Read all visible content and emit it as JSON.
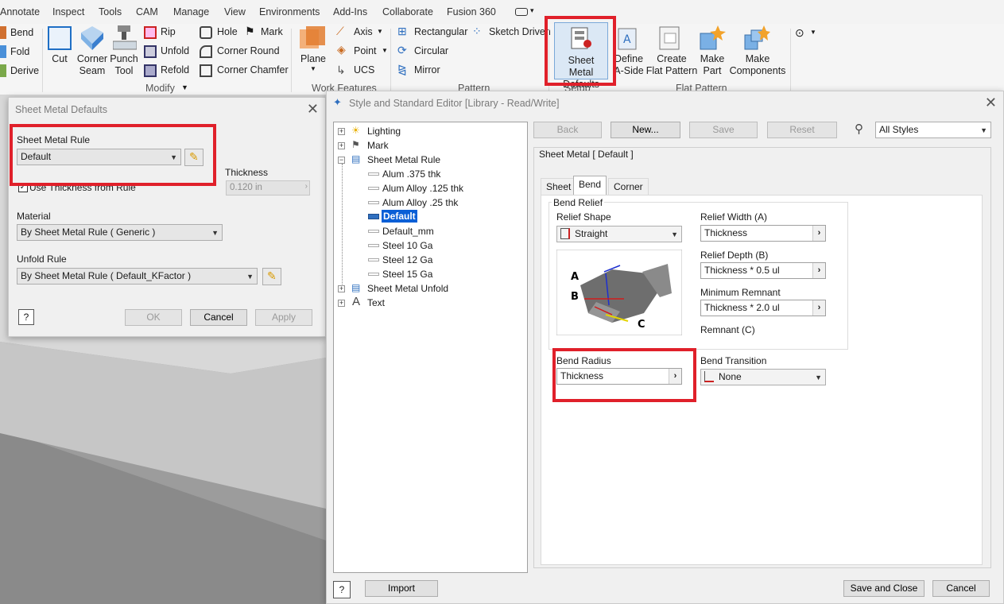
{
  "menubar": {
    "items": [
      "Annotate",
      "Inspect",
      "Tools",
      "CAM",
      "Manage",
      "View",
      "Environments",
      "Add-Ins",
      "Collaborate",
      "Fusion 360"
    ]
  },
  "ribbon": {
    "bend_group": [
      "Bend",
      "Fold",
      "Derive"
    ],
    "modify": {
      "cut": "Cut",
      "corner_seam": [
        "Corner",
        "Seam"
      ],
      "punch_tool": [
        "Punch",
        "Tool"
      ],
      "rip": "Rip",
      "unfold": "Unfold",
      "refold": "Refold",
      "hole": "Hole",
      "mark": "Mark",
      "corner_round": "Corner Round",
      "corner_chamfer": "Corner Chamfer",
      "panel_label": "Modify"
    },
    "work_features": {
      "plane": "Plane",
      "axis": "Axis",
      "point": "Point",
      "ucs": "UCS",
      "panel_label": "Work Features"
    },
    "pattern": {
      "rectangular": "Rectangular",
      "circular": "Circular",
      "mirror": "Mirror",
      "sketch_driven": "Sketch Driven",
      "panel_label": "Pattern"
    },
    "setup": {
      "sheet_metal_defaults": [
        "Sheet Metal",
        "Defaults"
      ],
      "panel_label": "Setup"
    },
    "flat_pattern": {
      "define_a_side": [
        "Define",
        "A-Side"
      ],
      "create_flat_pattern": [
        "Create",
        "Flat Pattern"
      ],
      "make_part": [
        "Make",
        "Part"
      ],
      "make_components": [
        "Make",
        "Components"
      ],
      "panel_label": "Flat Pattern"
    }
  },
  "smd_dialog": {
    "title": "Sheet Metal Defaults",
    "sheet_metal_rule_label": "Sheet Metal Rule",
    "sheet_metal_rule_value": "Default",
    "use_thickness_label": "Use Thickness from Rule",
    "thickness_label": "Thickness",
    "thickness_value": "0.120 in",
    "material_label": "Material",
    "material_value": "By Sheet Metal Rule ( Generic )",
    "unfold_rule_label": "Unfold Rule",
    "unfold_rule_value": "By Sheet Metal Rule ( Default_KFactor )",
    "ok": "OK",
    "cancel": "Cancel",
    "apply": "Apply"
  },
  "sse_dialog": {
    "title": "Style and Standard Editor [Library - Read/Write]",
    "tree": {
      "lighting": "Lighting",
      "mark": "Mark",
      "sheet_metal_rule": "Sheet Metal Rule",
      "children": [
        "Alum .375 thk",
        "Alum Alloy .125 thk",
        "Alum Alloy .25 thk",
        "Default",
        "Default_mm",
        "Steel 10 Ga",
        "Steel 12 Ga",
        "Steel 15 Ga"
      ],
      "sheet_metal_unfold": "Sheet Metal Unfold",
      "text": "Text"
    },
    "toolbar": {
      "back": "Back",
      "new": "New...",
      "save": "Save",
      "reset": "Reset",
      "filter": "All Styles"
    },
    "header": "Sheet Metal [ Default ]",
    "tabs": [
      "Sheet",
      "Bend",
      "Corner"
    ],
    "bend_relief": {
      "group_label": "Bend Relief",
      "relief_shape_label": "Relief Shape",
      "relief_shape_value": "Straight",
      "relief_width_label": "Relief Width (A)",
      "relief_width_value": "Thickness",
      "relief_depth_label": "Relief Depth (B)",
      "relief_depth_value": "Thickness * 0.5 ul",
      "min_remnant_label": "Minimum Remnant",
      "min_remnant_value": "Thickness * 2.0 ul",
      "remnant_label": "Remnant (C)",
      "diagram_labels": [
        "A",
        "B",
        "C"
      ]
    },
    "bend_radius_label": "Bend Radius",
    "bend_radius_value": "Thickness",
    "bend_transition_label": "Bend Transition",
    "bend_transition_value": "None",
    "import": "Import",
    "save_and_close": "Save and Close",
    "cancel": "Cancel"
  }
}
